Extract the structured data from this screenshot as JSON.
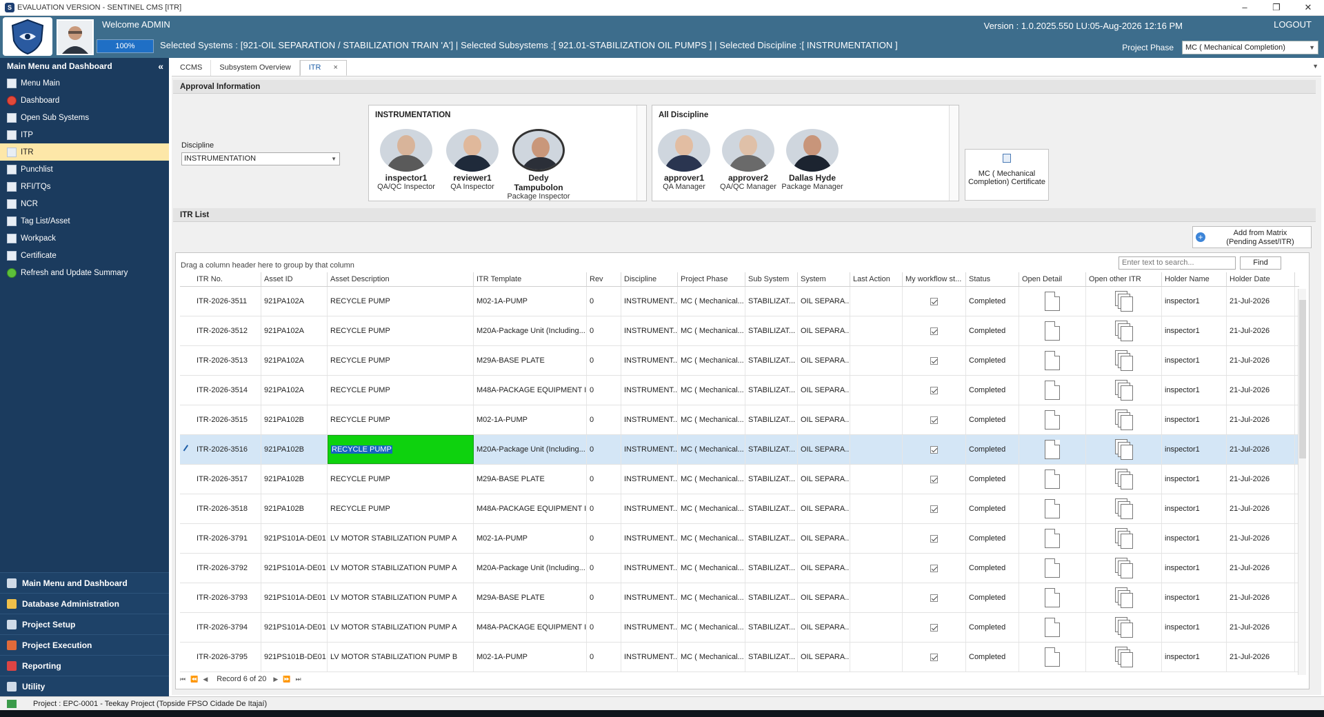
{
  "window": {
    "title": "EVALUATION VERSION - SENTINEL CMS [ITR]",
    "controls": [
      "–",
      "❐",
      "✕"
    ]
  },
  "header": {
    "welcome": "Welcome ADMIN",
    "progress": {
      "value": 1.0,
      "label": "100%"
    },
    "selection": "Selected Systems : [921-OIL SEPARATION / STABILIZATION TRAIN 'A'] | Selected Subsystems :[ 921.01-STABILIZATION OIL PUMPS ] | Selected Discipline :[ INSTRUMENTATION ]",
    "version": "Version : 1.0.2025.550 LU:05-Aug-2026 12:16 PM",
    "logout": "LOGOUT",
    "phase_label": "Project Phase",
    "phase_value": "MC ( Mechanical Completion)"
  },
  "sidebar": {
    "title": "Main Menu and Dashboard",
    "collapse": "«",
    "items": [
      {
        "label": "Menu Main"
      },
      {
        "label": "Dashboard"
      },
      {
        "label": "Open Sub Systems"
      },
      {
        "label": "ITP"
      },
      {
        "label": "ITR"
      },
      {
        "label": "Punchlist"
      },
      {
        "label": "RFI/TQs"
      },
      {
        "label": "NCR"
      },
      {
        "label": "Tag List/Asset"
      },
      {
        "label": "Workpack"
      },
      {
        "label": "Certificate"
      },
      {
        "label": "Refresh and Update Summary"
      }
    ],
    "groups": [
      {
        "label": "Main Menu and Dashboard"
      },
      {
        "label": "Database Administration"
      },
      {
        "label": "Project Setup"
      },
      {
        "label": "Project Execution"
      },
      {
        "label": "Reporting"
      },
      {
        "label": "Utility"
      }
    ]
  },
  "tabs": [
    {
      "label": "CCMS"
    },
    {
      "label": "Subsystem Overview"
    },
    {
      "label": "ITR",
      "close": "×"
    }
  ],
  "approval": {
    "title": "Approval Information",
    "discipline_label": "Discipline",
    "discipline_value": "INSTRUMENTATION",
    "panel1_title": "INSTRUMENTATION",
    "panel1": [
      {
        "name": "inspector1",
        "role": "QA/QC Inspector"
      },
      {
        "name": "reviewer1",
        "role": "QA Inspector"
      },
      {
        "name": "Dedy Tampubolon",
        "role": "Package Inspector"
      }
    ],
    "panel2_title": "All Discipline",
    "panel2": [
      {
        "name": "approver1",
        "role": "QA Manager"
      },
      {
        "name": "approver2",
        "role": "QA/QC Manager"
      },
      {
        "name": "Dallas Hyde",
        "role": "Package Manager"
      }
    ],
    "certificate": "MC ( Mechanical Completion) Certificate"
  },
  "itr": {
    "title": "ITR List",
    "add_button": "Add from Matrix (Pending Asset/ITR)",
    "group_hint": "Drag a column header here to group by that column",
    "search_placeholder": "Enter text to search...",
    "find": "Find",
    "columns": [
      "ITR No.",
      "Asset ID",
      "Asset Description",
      "ITR Template",
      "Rev",
      "Discipline",
      "Project Phase",
      "Sub System",
      "System",
      "Last Action",
      "My workflow st...",
      "Status",
      "Open Detail",
      "Open other ITR",
      "Holder Name",
      "Holder Date"
    ],
    "rows": [
      {
        "itr": "ITR-2026-3511",
        "asset": "921PA102A",
        "desc": "RECYCLE PUMP",
        "tpl": "M02-1A-PUMP",
        "rev": "0",
        "disc": "INSTRUMENT...",
        "phase": "MC ( Mechanical...",
        "sub": "STABILIZAT...",
        "sys": "OIL SEPARA...",
        "last": "",
        "status": "Completed",
        "holder": "inspector1",
        "date": "21-Jul-2026"
      },
      {
        "itr": "ITR-2026-3512",
        "asset": "921PA102A",
        "desc": "RECYCLE PUMP",
        "tpl": "M20A-Package Unit (Including...",
        "rev": "0",
        "disc": "INSTRUMENT...",
        "phase": "MC ( Mechanical...",
        "sub": "STABILIZAT...",
        "sys": "OIL SEPARA...",
        "last": "",
        "status": "Completed",
        "holder": "inspector1",
        "date": "21-Jul-2026"
      },
      {
        "itr": "ITR-2026-3513",
        "asset": "921PA102A",
        "desc": "RECYCLE PUMP",
        "tpl": "M29A-BASE PLATE",
        "rev": "0",
        "disc": "INSTRUMENT...",
        "phase": "MC ( Mechanical...",
        "sub": "STABILIZAT...",
        "sys": "OIL SEPARA...",
        "last": "",
        "status": "Completed",
        "holder": "inspector1",
        "date": "21-Jul-2026"
      },
      {
        "itr": "ITR-2026-3514",
        "asset": "921PA102A",
        "desc": "RECYCLE PUMP",
        "tpl": "M48A-PACKAGE EQUIPMENT I...",
        "rev": "0",
        "disc": "INSTRUMENT...",
        "phase": "MC ( Mechanical...",
        "sub": "STABILIZAT...",
        "sys": "OIL SEPARA...",
        "last": "",
        "status": "Completed",
        "holder": "inspector1",
        "date": "21-Jul-2026"
      },
      {
        "itr": "ITR-2026-3515",
        "asset": "921PA102B",
        "desc": "RECYCLE PUMP",
        "tpl": "M02-1A-PUMP",
        "rev": "0",
        "disc": "INSTRUMENT...",
        "phase": "MC ( Mechanical...",
        "sub": "STABILIZAT...",
        "sys": "OIL SEPARA...",
        "last": "",
        "status": "Completed",
        "holder": "inspector1",
        "date": "21-Jul-2026"
      },
      {
        "itr": "ITR-2026-3516",
        "asset": "921PA102B",
        "desc": "RECYCLE PUMP",
        "tpl": "M20A-Package Unit (Including...",
        "rev": "0",
        "disc": "INSTRUMENT...",
        "phase": "MC ( Mechanical...",
        "sub": "STABILIZAT...",
        "sys": "OIL SEPARA...",
        "last": "",
        "status": "Completed",
        "holder": "inspector1",
        "date": "21-Jul-2026"
      },
      {
        "itr": "ITR-2026-3517",
        "asset": "921PA102B",
        "desc": "RECYCLE PUMP",
        "tpl": "M29A-BASE PLATE",
        "rev": "0",
        "disc": "INSTRUMENT...",
        "phase": "MC ( Mechanical...",
        "sub": "STABILIZAT...",
        "sys": "OIL SEPARA...",
        "last": "",
        "status": "Completed",
        "holder": "inspector1",
        "date": "21-Jul-2026"
      },
      {
        "itr": "ITR-2026-3518",
        "asset": "921PA102B",
        "desc": "RECYCLE PUMP",
        "tpl": "M48A-PACKAGE EQUIPMENT I...",
        "rev": "0",
        "disc": "INSTRUMENT...",
        "phase": "MC ( Mechanical...",
        "sub": "STABILIZAT...",
        "sys": "OIL SEPARA...",
        "last": "",
        "status": "Completed",
        "holder": "inspector1",
        "date": "21-Jul-2026"
      },
      {
        "itr": "ITR-2026-3791",
        "asset": "921PS101A-DE01",
        "desc": "LV MOTOR STABILIZATION PUMP A",
        "tpl": "M02-1A-PUMP",
        "rev": "0",
        "disc": "INSTRUMENT...",
        "phase": "MC ( Mechanical...",
        "sub": "STABILIZAT...",
        "sys": "OIL SEPARA...",
        "last": "",
        "status": "Completed",
        "holder": "inspector1",
        "date": "21-Jul-2026"
      },
      {
        "itr": "ITR-2026-3792",
        "asset": "921PS101A-DE01",
        "desc": "LV MOTOR STABILIZATION PUMP A",
        "tpl": "M20A-Package Unit (Including...",
        "rev": "0",
        "disc": "INSTRUMENT...",
        "phase": "MC ( Mechanical...",
        "sub": "STABILIZAT...",
        "sys": "OIL SEPARA...",
        "last": "",
        "status": "Completed",
        "holder": "inspector1",
        "date": "21-Jul-2026"
      },
      {
        "itr": "ITR-2026-3793",
        "asset": "921PS101A-DE01",
        "desc": "LV MOTOR STABILIZATION PUMP A",
        "tpl": "M29A-BASE PLATE",
        "rev": "0",
        "disc": "INSTRUMENT...",
        "phase": "MC ( Mechanical...",
        "sub": "STABILIZAT...",
        "sys": "OIL SEPARA...",
        "last": "",
        "status": "Completed",
        "holder": "inspector1",
        "date": "21-Jul-2026"
      },
      {
        "itr": "ITR-2026-3794",
        "asset": "921PS101A-DE01",
        "desc": "LV MOTOR STABILIZATION PUMP A",
        "tpl": "M48A-PACKAGE EQUIPMENT I...",
        "rev": "0",
        "disc": "INSTRUMENT...",
        "phase": "MC ( Mechanical...",
        "sub": "STABILIZAT...",
        "sys": "OIL SEPARA...",
        "last": "",
        "status": "Completed",
        "holder": "inspector1",
        "date": "21-Jul-2026"
      },
      {
        "itr": "ITR-2026-3795",
        "asset": "921PS101B-DE01",
        "desc": "LV MOTOR STABILIZATION PUMP B",
        "tpl": "M02-1A-PUMP",
        "rev": "0",
        "disc": "INSTRUMENT...",
        "phase": "MC ( Mechanical...",
        "sub": "STABILIZAT...",
        "sys": "OIL SEPARA...",
        "last": "",
        "status": "Completed",
        "holder": "inspector1",
        "date": "21-Jul-2026"
      }
    ],
    "record_nav": "Record 6 of 20"
  },
  "statusbar": {
    "project": "Project : EPC-0001 - Teekay Project (Topside FPSO Cidade De Itajaí)"
  }
}
